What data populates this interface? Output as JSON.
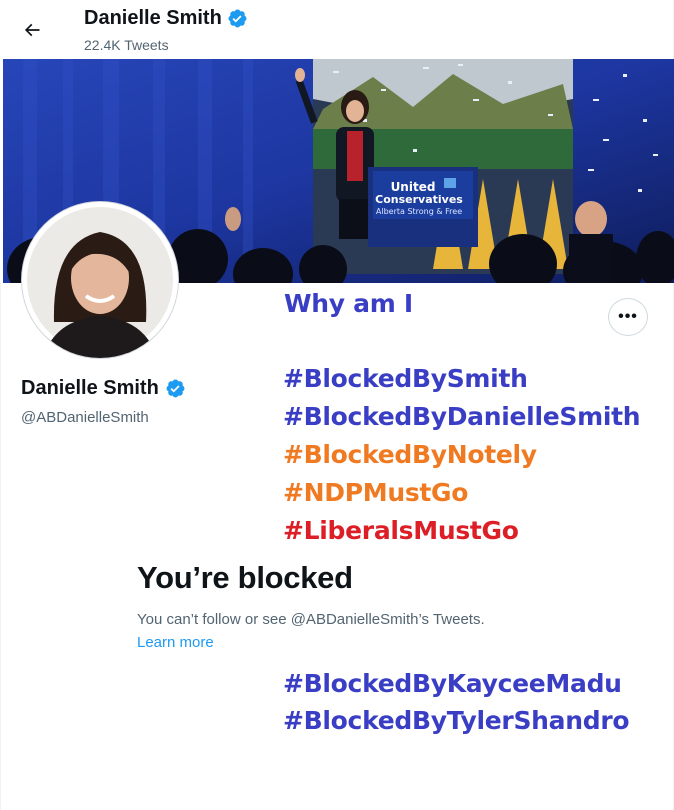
{
  "header": {
    "name": "Danielle Smith",
    "tweet_count": "22.4K Tweets"
  },
  "banner": {
    "sign_line1": "United",
    "sign_line2": "Conservatives",
    "sign_line3": "Alberta Strong & Free"
  },
  "profile": {
    "name": "Danielle Smith",
    "handle": "@ABDanielleSmith"
  },
  "more_button": {
    "label": "•••"
  },
  "overlay": {
    "question": "Why am I",
    "tags_top": [
      {
        "text": "#BlockedBySmith",
        "color": "#3a3ec4"
      },
      {
        "text": "#BlockedByDanielleSmith",
        "color": "#3a3ec4"
      },
      {
        "text": "#BlockedByNotely",
        "color": "#f07a22"
      },
      {
        "text": "#NDPMustGo",
        "color": "#f07a22"
      },
      {
        "text": "#LiberalsMustGo",
        "color": "#dc1f26"
      }
    ],
    "tags_bottom": [
      {
        "text": "#BlockedByKayceeMadu",
        "color": "#3a3ec4"
      },
      {
        "text": "#BlockedByTylerShandro",
        "color": "#3a3ec4"
      }
    ]
  },
  "blocked": {
    "title": "You’re blocked",
    "description": "You can’t follow or see @ABDanielleSmith’s Tweets.",
    "learn_more": "Learn more"
  },
  "colors": {
    "verified": "#1d9bf0",
    "link": "#1d9bf0",
    "secondary_text": "#536471"
  },
  "icons": [
    "back-arrow-icon",
    "verified-badge-icon",
    "more-icon"
  ]
}
